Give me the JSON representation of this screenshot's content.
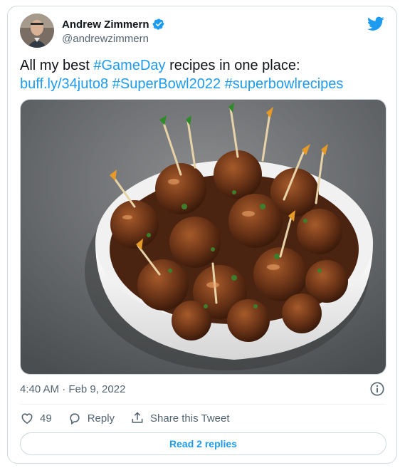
{
  "author": {
    "name": "Andrew Zimmern",
    "handle": "@andrewzimmern",
    "verified": true
  },
  "tweet": {
    "text_segments": [
      {
        "text": "All my best ",
        "kind": "plain"
      },
      {
        "text": "#GameDay",
        "kind": "hashtag"
      },
      {
        "text": " recipes in one place:",
        "kind": "plain"
      },
      {
        "text": "buff.ly/34juto8",
        "kind": "link"
      },
      {
        "text": " ",
        "kind": "plain"
      },
      {
        "text": "#SuperBowl2022",
        "kind": "hashtag"
      },
      {
        "text": " ",
        "kind": "plain"
      },
      {
        "text": "#superbowlrecipes",
        "kind": "hashtag"
      }
    ],
    "timestamp": "4:40 AM · Feb 9, 2022"
  },
  "actions": {
    "like_count": "49",
    "reply_label": "Reply",
    "share_label": "Share this Tweet"
  },
  "read_replies_label": "Read 2 replies",
  "colors": {
    "accent": "#1d9bf0",
    "text": "#0f1419",
    "muted": "#536471",
    "border": "#cfd9de"
  },
  "icons": {
    "platform": "twitter-bird-icon",
    "verified": "verified-badge-icon",
    "info": "info-icon",
    "like": "heart-icon",
    "reply": "reply-bubble-icon",
    "share": "share-icon"
  }
}
